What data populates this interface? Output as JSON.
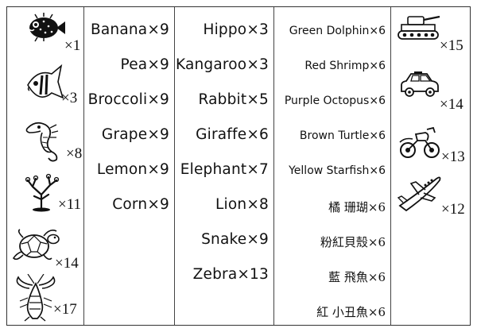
{
  "left_panel": {
    "items": [
      {
        "icon": "pufferfish-icon",
        "qty": "×1"
      },
      {
        "icon": "angelfish-icon",
        "qty": "×3"
      },
      {
        "icon": "seahorse-icon",
        "qty": "×8"
      },
      {
        "icon": "coral-icon",
        "qty": "×11"
      },
      {
        "icon": "sea-turtle-icon",
        "qty": "×14"
      },
      {
        "icon": "lobster-icon",
        "qty": "×17"
      }
    ]
  },
  "fruits": [
    "Banana×9",
    "Pea×9",
    "Broccoli×9",
    "Grape×9",
    "Lemon×9",
    "Corn×9"
  ],
  "animals": [
    "Hippo×3",
    "Kangaroo×3",
    "Rabbit×5",
    "Giraffe×6",
    "Elephant×7",
    "Lion×8",
    "Snake×9",
    "Zebra×13"
  ],
  "sea": [
    "Green Dolphin×6",
    "Red Shrimp×6",
    "Purple Octopus×6",
    "Brown Turtle×6",
    "Yellow Starfish×6",
    "橘 珊瑚×6",
    "粉紅貝殼×6",
    "藍 飛魚×6",
    "紅 小丑魚×6"
  ],
  "right_panel": {
    "items": [
      {
        "icon": "tank-icon",
        "qty": "×15"
      },
      {
        "icon": "car-icon",
        "qty": "×14"
      },
      {
        "icon": "motorcycle-icon",
        "qty": "×13"
      },
      {
        "icon": "airplane-icon",
        "qty": "×12"
      }
    ]
  }
}
